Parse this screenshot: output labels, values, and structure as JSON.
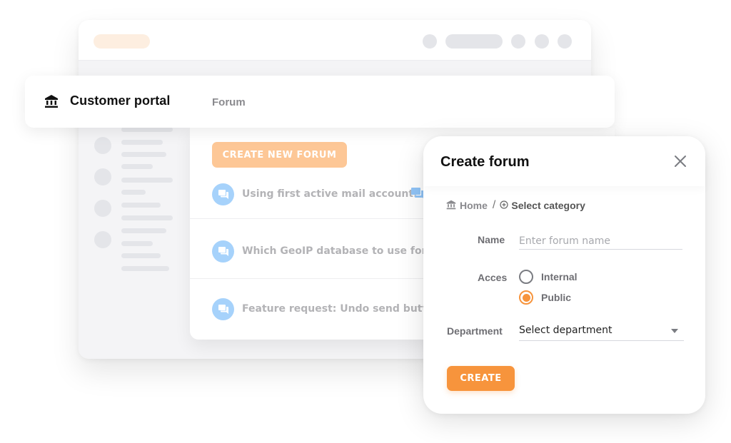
{
  "header": {
    "app_title": "Customer portal",
    "app_icon": "bank-icon",
    "section": "Forum"
  },
  "forum": {
    "create_new_label": "CREATE NEW FORUM",
    "items": [
      {
        "icon": "chat-icon",
        "title": "Using first active mail account."
      },
      {
        "icon": "chat-icon",
        "title": "Which GeoIP database to use for the"
      },
      {
        "icon": "chat-icon",
        "title": "Feature request: Undo send button f"
      }
    ]
  },
  "modal": {
    "title": "Create forum",
    "close_icon": "close-icon",
    "breadcrumb": {
      "home_icon": "bank-icon",
      "home_label": "Home",
      "separator": "/",
      "category_icon": "plus-circle-icon",
      "category_label": "Select category"
    },
    "name_label": "Name",
    "name_placeholder": "Enter forum name",
    "name_value": "",
    "access_label": "Acces",
    "access_options": [
      {
        "label": "Internal",
        "checked": false
      },
      {
        "label": "Public",
        "checked": true
      }
    ],
    "department_label": "Department",
    "department_value": "Select department",
    "create_label": "CREATE"
  },
  "colors": {
    "accent": "#f7943c",
    "accent_light": "#fdc796",
    "chat_icon_bg": "#a6d2fb"
  }
}
